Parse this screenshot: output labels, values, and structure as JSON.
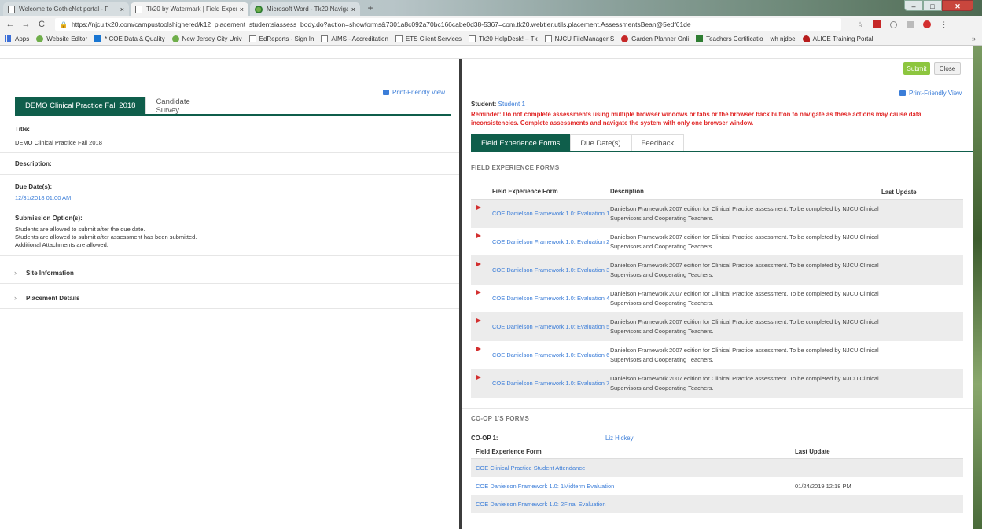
{
  "browser": {
    "tabs": [
      {
        "label": "Welcome to GothicNet portal - F",
        "icon": "page-icon"
      },
      {
        "label": "Tk20 by Watermark | Field Experi",
        "icon": "page-icon"
      },
      {
        "label": "Microsoft Word - Tk20 Navigati",
        "icon": "wix-icon"
      }
    ],
    "new_tab": "+",
    "url": "https://njcu.tk20.com/campustoolshighered/k12_placement_studentsiassess_body.do?action=showforms&7301a8c092a70bc166cabe0d38-5367=com.tk20.webtier.utils.placement.AssessmentsBean@5edf61de",
    "bookmarks": [
      {
        "label": "Apps",
        "icon": "apps"
      },
      {
        "label": "Website Editor",
        "icon": "wix"
      },
      {
        "label": "* COE Data & Quality",
        "icon": "trello"
      },
      {
        "label": "New Jersey City Univ",
        "icon": "wix"
      },
      {
        "label": "EdReports - Sign In",
        "icon": "page"
      },
      {
        "label": "AIMS - Accreditation",
        "icon": "page"
      },
      {
        "label": "ETS Client Services",
        "icon": "page"
      },
      {
        "label": "Tk20 HelpDesk! – Tk",
        "icon": "page"
      },
      {
        "label": "NJCU FileManager S",
        "icon": "page"
      },
      {
        "label": "Garden Planner Onli",
        "icon": "garden"
      },
      {
        "label": "Teachers Certificatio",
        "icon": "teach"
      },
      {
        "label": "wh njdoe",
        "icon": "none"
      },
      {
        "label": "ALICE Training Portal",
        "icon": "alice"
      }
    ],
    "bookmarks_more": "»"
  },
  "left": {
    "print_label": "Print-Friendly View",
    "tabs": [
      "DEMO Clinical Practice Fall 2018",
      "Candidate Survey"
    ],
    "title_label": "Title:",
    "title_value": "DEMO Clinical Practice Fall 2018",
    "description_label": "Description:",
    "due_label": "Due Date(s):",
    "due_value": "12/31/2018 01:00 AM",
    "submission_label": "Submission Option(s):",
    "submission_lines": [
      "Students are allowed to submit after the due date.",
      "Students are allowed to submit after assessment has been submitted.",
      "Additional Attachments are allowed."
    ],
    "accordions": [
      "Site Information",
      "Placement Details"
    ]
  },
  "right": {
    "submit_label": "Submit",
    "close_label": "Close",
    "print_label": "Print-Friendly View",
    "student_label": "Student:",
    "student_value": "Student 1",
    "reminder": "Reminder: Do not complete assessments using multiple browser windows or tabs or the browser back button to navigate as these actions may cause data inconsistencies. Complete assessments and navigate the system with only one browser window.",
    "tabs": [
      "Field Experience Forms",
      "Due Date(s)",
      "Feedback"
    ],
    "fe_section_title": "FIELD EXPERIENCE FORMS",
    "fe_headers": [
      "Field Experience Form",
      "Description",
      "Last Update"
    ],
    "fe_rows": [
      {
        "name": "COE Danielson Framework 1.0: Evaluation 1",
        "desc": "Danielson Framework 2007 edition for Clinical Practice assessment. To be completed by NJCU Clinical Supervisors and Cooperating Teachers.",
        "updated": ""
      },
      {
        "name": "COE Danielson Framework 1.0: Evaluation 2",
        "desc": "Danielson Framework 2007 edition for Clinical Practice assessment. To be completed by NJCU Clinical Supervisors and Cooperating Teachers.",
        "updated": ""
      },
      {
        "name": "COE Danielson Framework 1.0: Evaluation 3",
        "desc": "Danielson Framework 2007 edition for Clinical Practice assessment. To be completed by NJCU Clinical Supervisors and Cooperating Teachers.",
        "updated": ""
      },
      {
        "name": "COE Danielson Framework 1.0: Evaluation 4",
        "desc": "Danielson Framework 2007 edition for Clinical Practice assessment. To be completed by NJCU Clinical Supervisors and Cooperating Teachers.",
        "updated": ""
      },
      {
        "name": "COE Danielson Framework 1.0: Evaluation 5",
        "desc": "Danielson Framework 2007 edition for Clinical Practice assessment. To be completed by NJCU Clinical Supervisors and Cooperating Teachers.",
        "updated": ""
      },
      {
        "name": "COE Danielson Framework 1.0: Evaluation 6",
        "desc": "Danielson Framework 2007 edition for Clinical Practice assessment. To be completed by NJCU Clinical Supervisors and Cooperating Teachers.",
        "updated": ""
      },
      {
        "name": "COE Danielson Framework 1.0: Evaluation 7",
        "desc": "Danielson Framework 2007 edition for Clinical Practice assessment. To be completed by NJCU Clinical Supervisors and Cooperating Teachers.",
        "updated": ""
      }
    ],
    "coop_section_title": "CO-OP 1'S FORMS",
    "coop_label": "CO-OP 1:",
    "coop_value": "Liz Hickey",
    "coop_headers": [
      "Field Experience Form",
      "Last Update"
    ],
    "coop_rows": [
      {
        "name": "COE Clinical Practice Student Attendance",
        "updated": ""
      },
      {
        "name": "COE Danielson Framework 1.0: 1Midterm Evaluation",
        "updated": "01/24/2019 12:18 PM"
      },
      {
        "name": "COE Danielson Framework 1.0: 2Final Evaluation",
        "updated": ""
      }
    ]
  }
}
